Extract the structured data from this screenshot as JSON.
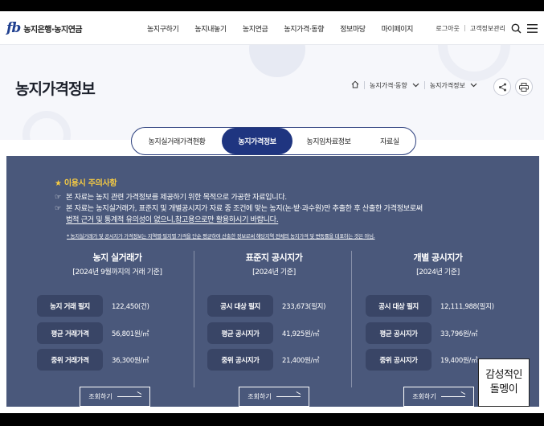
{
  "header": {
    "logo_mark": "fb",
    "logo_text": "농지은행·농지연금",
    "nav": [
      "농지구하기",
      "농지내놓기",
      "농지연금",
      "농지가격·동향",
      "정보마당",
      "마이페이지"
    ],
    "util": {
      "logout": "로그아웃",
      "manage": "고객정보관리"
    }
  },
  "hero": {
    "title": "농지가격정보",
    "breadcrumb": [
      "농지가격·동향",
      "농지가격정보"
    ]
  },
  "tabs": [
    {
      "label": "농지실거래가격현황",
      "active": false
    },
    {
      "label": "농지가격정보",
      "active": true
    },
    {
      "label": "농지임차료정보",
      "active": false
    },
    {
      "label": "자료실",
      "active": false
    }
  ],
  "notice": {
    "title": "★ 이용시 주의사항",
    "line1": "본 자료는 농지 관련 가격정보를 제공하기 위한 목적으로 가공한 자료입니다.",
    "line2": "본 자료는 농지실거래가, 표준지 및 개별공시지가 자료 중 조건에 맞는 농지(논·밭·과수원)만 추출한 후 산출한 가격정보로써",
    "line3": "법적 근거 및 통계적 유의성이 없으니,참고용으로만 활용하시기 바랍니다.",
    "foot": "* 농지실거래가 및 공시지가 가격정보는 지역별·필지별 가격을 단순 평균하여 산출한 정보로써 해당지역 전체의 농지가격 및 변동률을 대표하는 것은 아님."
  },
  "columns": [
    {
      "title": "농지 실거래가",
      "sub": "[2024년 9월까지의 거래 기준]",
      "rows": [
        {
          "label": "농지 거래 필지",
          "value": "122,450(건)"
        },
        {
          "label": "평균 거래가격",
          "value": "56,801원/㎡"
        },
        {
          "label": "중위 거래가격",
          "value": "36,300원/㎡"
        }
      ],
      "button": "조회하기"
    },
    {
      "title": "표준지 공시지가",
      "sub": "[2024년 기준]",
      "rows": [
        {
          "label": "공시 대상 필지",
          "value": "233,673(필지)"
        },
        {
          "label": "평균 공시지가",
          "value": "41,925원/㎡"
        },
        {
          "label": "중위 공시지가",
          "value": "21,400원/㎡"
        }
      ],
      "button": "조회하기"
    },
    {
      "title": "개별 공시지가",
      "sub": "[2024년 기준]",
      "rows": [
        {
          "label": "공시 대상 필지",
          "value": "12,111,988(필지)"
        },
        {
          "label": "평균 공시지가",
          "value": "33,796원/㎡"
        },
        {
          "label": "중위 공시지가",
          "value": "19,400원/㎡"
        }
      ],
      "button": "조회하기"
    }
  ],
  "stamp": {
    "line1": "감성적인",
    "line2": "돌멩이"
  },
  "colors": {
    "brand_navy": "#1f3580",
    "panel": "#4a587b",
    "label_bg": "#394566",
    "notice_star": "#f6cb43"
  }
}
